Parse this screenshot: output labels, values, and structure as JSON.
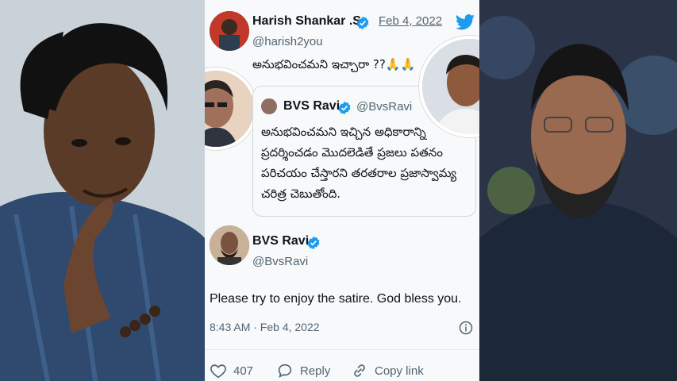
{
  "outer_tweet": {
    "name": "Harish Shankar .S",
    "date": "Feb 4, 2022",
    "handle": "@harish2you",
    "text": "అనుభవించమని ఇచ్చారా ??🙏🙏"
  },
  "quoted_tweet": {
    "name": "BVS Ravi",
    "handle": "@BvsRavi",
    "lines": [
      "అనుభవించమని ఇచ్చిన అధికారాన్ని",
      "ప్రదర్శించడం మొదలెడితే ప్రజలు పతనం",
      "పరిచయం చేస్తారని తరతరాల ప్రజాస్వామ్య",
      "చరిత్ర చెబుతోంది."
    ]
  },
  "main_tweet": {
    "name": "BVS Ravi",
    "handle": "@BvsRavi",
    "text": "Please try to enjoy the satire. God bless you.",
    "timestamp": "8:43 AM · Feb 4, 2022",
    "likes": "407",
    "reply_label": "Reply",
    "copy_label": "Copy link"
  },
  "colors": {
    "verified_blue": "#1d9bf0",
    "twitter_blue": "#1d9bf0",
    "text": "#0f1419",
    "muted": "#536471"
  }
}
